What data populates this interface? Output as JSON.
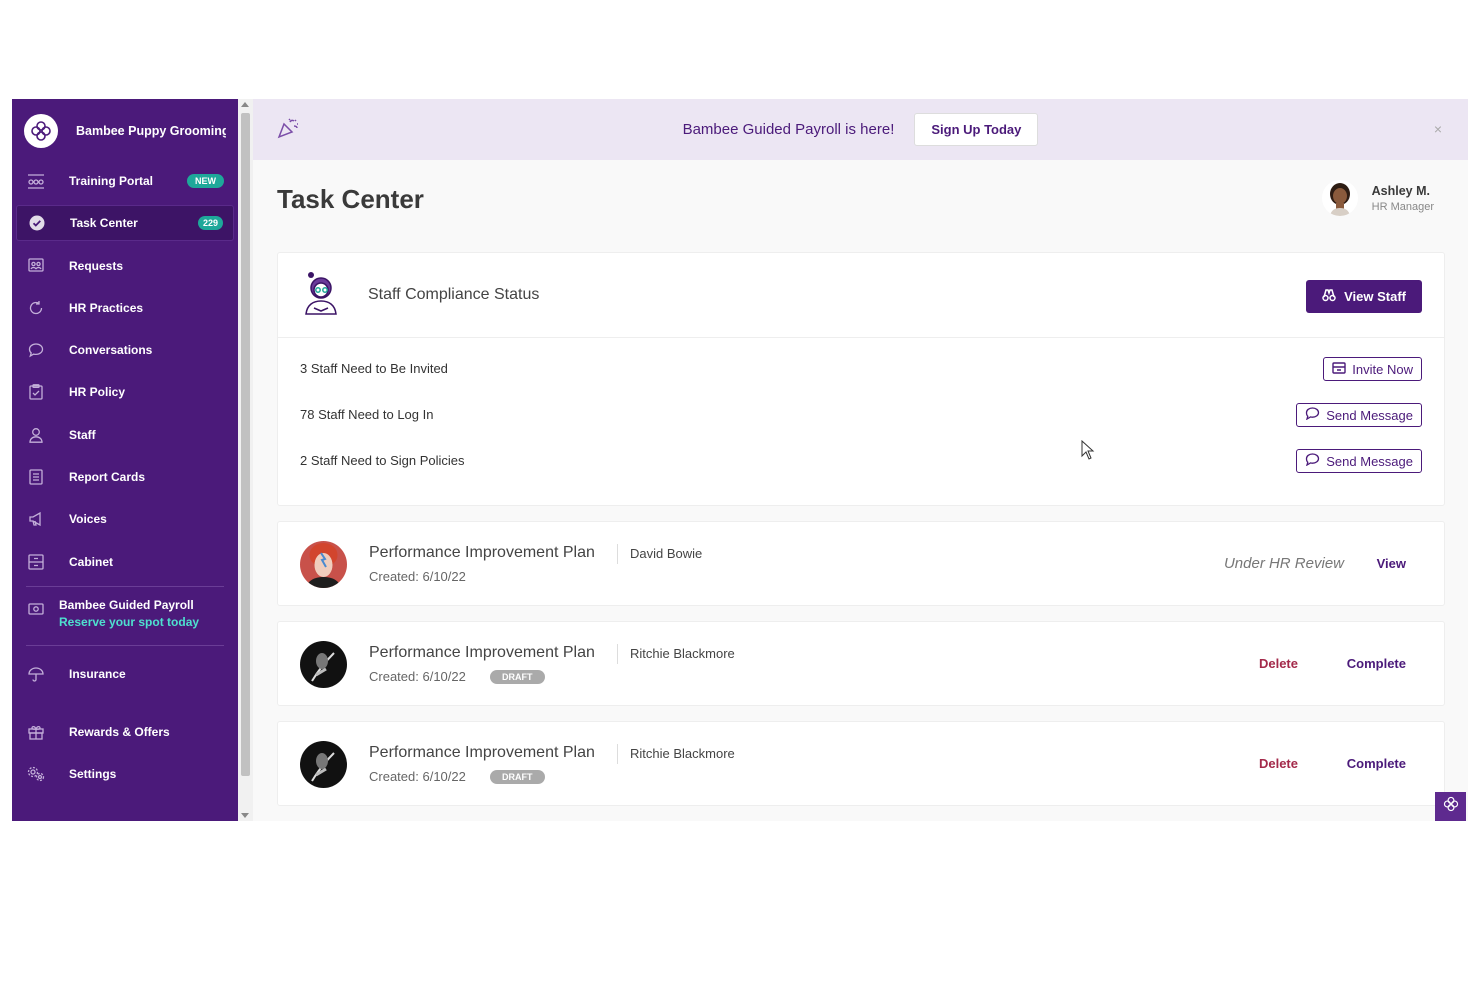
{
  "sidebar": {
    "brand_name": "Bambee Puppy Grooming",
    "items": [
      {
        "label": "Training Portal",
        "badge": "NEW",
        "icon": "training-icon"
      },
      {
        "label": "Task Center",
        "badge": "229",
        "icon": "check-circle-icon"
      },
      {
        "label": "Requests",
        "icon": "requests-icon"
      },
      {
        "label": "HR Practices",
        "icon": "refresh-icon"
      },
      {
        "label": "Conversations",
        "icon": "chat-icon"
      },
      {
        "label": "HR Policy",
        "icon": "clipboard-icon"
      },
      {
        "label": "Staff",
        "icon": "person-icon"
      },
      {
        "label": "Report Cards",
        "icon": "report-icon"
      },
      {
        "label": "Voices",
        "icon": "megaphone-icon"
      },
      {
        "label": "Cabinet",
        "icon": "cabinet-icon"
      }
    ],
    "payroll": {
      "title": "Bambee Guided Payroll",
      "subtitle": "Reserve your spot today"
    },
    "insurance": "Insurance",
    "rewards": "Rewards & Offers",
    "settings": "Settings"
  },
  "banner": {
    "text": "Bambee Guided Payroll is here!",
    "button": "Sign Up Today",
    "close": "×"
  },
  "page": {
    "title": "Task Center"
  },
  "user": {
    "name": "Ashley M.",
    "role": "HR Manager"
  },
  "compliance": {
    "title": "Staff Compliance Status",
    "view_button": "View Staff",
    "rows": [
      {
        "label": "3 Staff Need to Be Invited",
        "action": "Invite Now"
      },
      {
        "label": "78 Staff Need to Log In",
        "action": "Send Message"
      },
      {
        "label": "2 Staff Need to Sign Policies",
        "action": "Send Message"
      }
    ]
  },
  "plans": [
    {
      "title": "Performance Improvement Plan",
      "person": "David Bowie",
      "created": "Created: 6/10/22",
      "status": "Under HR Review",
      "action": "View"
    },
    {
      "title": "Performance Improvement Plan",
      "person": "Ritchie Blackmore",
      "created": "Created: 6/10/22",
      "tag": "DRAFT",
      "delete": "Delete",
      "complete": "Complete"
    },
    {
      "title": "Performance Improvement Plan",
      "person": "Ritchie Blackmore",
      "created": "Created: 6/10/22",
      "tag": "DRAFT",
      "delete": "Delete",
      "complete": "Complete"
    }
  ],
  "colors": {
    "sidebar": "#4b1a7a",
    "accent": "#4b1a7a",
    "badge": "#1ea89a",
    "link_highlight": "#4ee0cf",
    "delete": "#a3294a",
    "banner_bg": "#ece6f3"
  }
}
